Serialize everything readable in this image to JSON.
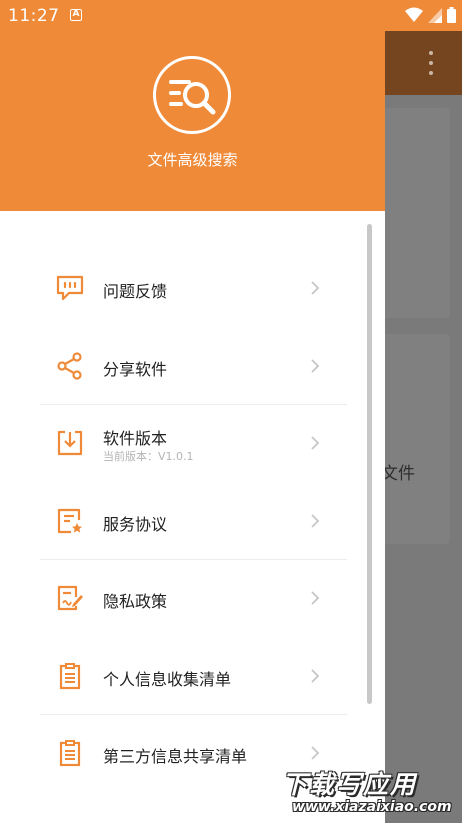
{
  "status_bar": {
    "time": "11:27",
    "notification_letter": "A",
    "icons": [
      "wifi-icon",
      "signal-icon",
      "battery-icon"
    ]
  },
  "drawer": {
    "header": {
      "app_name": "文件高级搜索",
      "logo_icon": "file-search-icon"
    },
    "items": [
      {
        "label": "问题反馈",
        "icon": "feedback-icon"
      },
      {
        "label": "分享软件",
        "icon": "share-icon"
      },
      {
        "label": "软件版本",
        "sublabel": "当前版本：V1.0.1",
        "icon": "version-download-icon"
      },
      {
        "label": "服务协议",
        "icon": "service-agreement-icon"
      },
      {
        "label": "隐私政策",
        "icon": "privacy-policy-icon"
      },
      {
        "label": "个人信息收集清单",
        "icon": "personal-info-list-icon"
      },
      {
        "label": "第三方信息共享清单",
        "icon": "third-party-share-list-icon"
      }
    ]
  },
  "background": {
    "partial_text": "文件"
  },
  "watermark": {
    "title": "下载写应用",
    "url": "www.xiazaixiao.com"
  },
  "colors": {
    "accent": "#ef8a39",
    "dim_toolbar": "#74451f",
    "text_primary": "#222222",
    "text_secondary": "#b4b4b4"
  }
}
